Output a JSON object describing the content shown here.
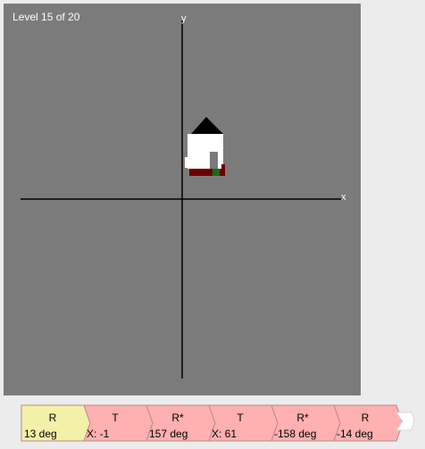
{
  "level_label": "Level 15 of 20",
  "axes": {
    "x_label": "x",
    "y_label": "y"
  },
  "colors": {
    "canvas_bg": "#7b7b7b",
    "active_step": "#f2f1a8",
    "step": "#ffb0b0",
    "roof": "#000000",
    "wall": "#ffffff",
    "door": "#7a7a7a",
    "base": "#6b0000",
    "marker": "#1a6b1a"
  },
  "steps": [
    {
      "type": "R",
      "param": "13 deg",
      "active": true
    },
    {
      "type": "T",
      "param": "X: -1",
      "active": false
    },
    {
      "type": "R*",
      "param": "157 deg",
      "active": false
    },
    {
      "type": "T",
      "param": "X: 61",
      "active": false
    },
    {
      "type": "R*",
      "param": "-158 deg",
      "active": false
    },
    {
      "type": "R",
      "param": "-14 deg",
      "active": false
    }
  ]
}
